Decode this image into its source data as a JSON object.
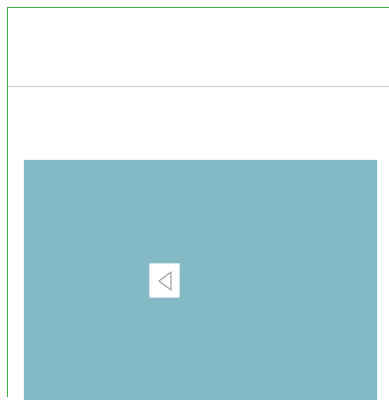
{
  "colors": {
    "frame_border": "#3fae3f",
    "divider": "#c9c9c9",
    "panel_background": "#84b9c6",
    "button_background": "#ffffff",
    "icon_stroke": "#9aa2a6"
  },
  "content_panel": {
    "prev_button": {
      "icon": "triangle-left-icon"
    }
  }
}
